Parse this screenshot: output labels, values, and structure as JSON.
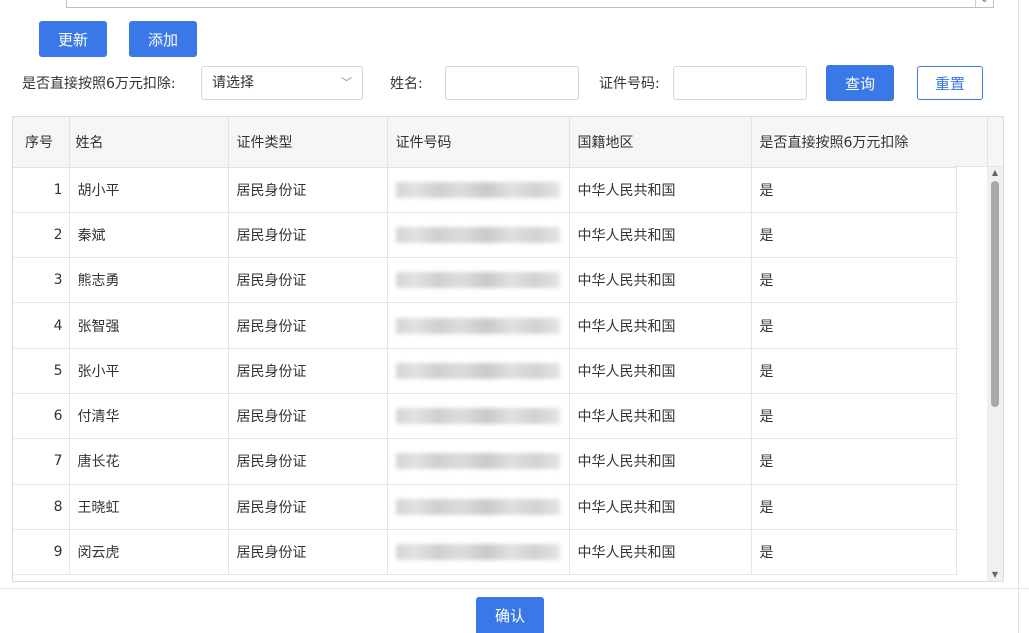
{
  "toolbar": {
    "refresh_label": "更新",
    "add_label": "添加"
  },
  "filters": {
    "deduct_label": "是否直接按照6万元扣除:",
    "deduct_select_value": "请选择",
    "name_label": "姓名:",
    "id_label": "证件号码:",
    "query_label": "查询",
    "reset_label": "重置"
  },
  "table": {
    "headers": [
      "序号",
      "姓名",
      "证件类型",
      "证件号码",
      "国籍地区",
      "是否直接按照6万元扣除"
    ],
    "rows": [
      {
        "no": "1",
        "name": "胡小平",
        "id_type": "居民身份证",
        "country": "中华人民共和国",
        "deduct": "是"
      },
      {
        "no": "2",
        "name": "秦斌",
        "id_type": "居民身份证",
        "country": "中华人民共和国",
        "deduct": "是"
      },
      {
        "no": "3",
        "name": "熊志勇",
        "id_type": "居民身份证",
        "country": "中华人民共和国",
        "deduct": "是"
      },
      {
        "no": "4",
        "name": "张智强",
        "id_type": "居民身份证",
        "country": "中华人民共和国",
        "deduct": "是"
      },
      {
        "no": "5",
        "name": "张小平",
        "id_type": "居民身份证",
        "country": "中华人民共和国",
        "deduct": "是"
      },
      {
        "no": "6",
        "name": "付清华",
        "id_type": "居民身份证",
        "country": "中华人民共和国",
        "deduct": "是"
      },
      {
        "no": "7",
        "name": "唐长花",
        "id_type": "居民身份证",
        "country": "中华人民共和国",
        "deduct": "是"
      },
      {
        "no": "8",
        "name": "王晓虹",
        "id_type": "居民身份证",
        "country": "中华人民共和国",
        "deduct": "是"
      },
      {
        "no": "9",
        "name": "闵云虎",
        "id_type": "居民身份证",
        "country": "中华人民共和国",
        "deduct": "是"
      }
    ]
  },
  "footer": {
    "confirm_label": "确认"
  },
  "icons": {
    "select_chevron": "chevron-down-icon",
    "scroll_up": "arrow-up-icon",
    "scroll_down": "arrow-down-icon"
  },
  "colors": {
    "primary": "#3a78e8",
    "header_bg": "#f5f6f8"
  }
}
